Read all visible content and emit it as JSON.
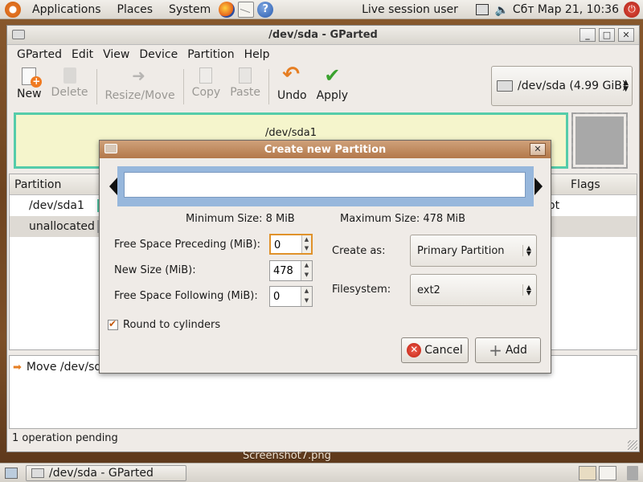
{
  "top_panel": {
    "menus": [
      "Applications",
      "Places",
      "System"
    ],
    "live_user": "Live session user",
    "clock": "Сбт Мар 21, 10:36"
  },
  "window": {
    "title": "/dev/sda - GParted",
    "menu": [
      "GParted",
      "Edit",
      "View",
      "Device",
      "Partition",
      "Help"
    ],
    "toolbar": {
      "new": "New",
      "delete": "Delete",
      "resize_move": "Resize/Move",
      "copy": "Copy",
      "paste": "Paste",
      "undo": "Undo",
      "apply": "Apply"
    },
    "device": "/dev/sda  (4.99 GiB)",
    "graph_partition_label": "/dev/sda1",
    "list": {
      "col_partition": "Partition",
      "col_flags": "Flags",
      "rows": [
        {
          "name": "/dev/sda1",
          "tail": "ot"
        },
        {
          "name": "unallocated",
          "tail": ""
        }
      ]
    },
    "operation": "Move /dev/sda",
    "status": "1 operation pending"
  },
  "dialog": {
    "title": "Create new Partition",
    "min_size": "Minimum Size: 8 MiB",
    "max_size": "Maximum Size: 478 MiB",
    "preceding_label": "Free Space Preceding (MiB):",
    "preceding_value": "0",
    "new_size_label": "New Size (MiB):",
    "new_size_value": "478",
    "following_label": "Free Space Following (MiB):",
    "following_value": "0",
    "create_as_label": "Create as:",
    "create_as_value": "Primary Partition",
    "filesystem_label": "Filesystem:",
    "filesystem_value": "ext2",
    "round_label": "Round to cylinders",
    "round_checked": true,
    "cancel": "Cancel",
    "add": "Add"
  },
  "desktop": {
    "screenshot_label": "Screenshot7.png"
  },
  "taskbar": {
    "task": "/dev/sda - GParted"
  }
}
